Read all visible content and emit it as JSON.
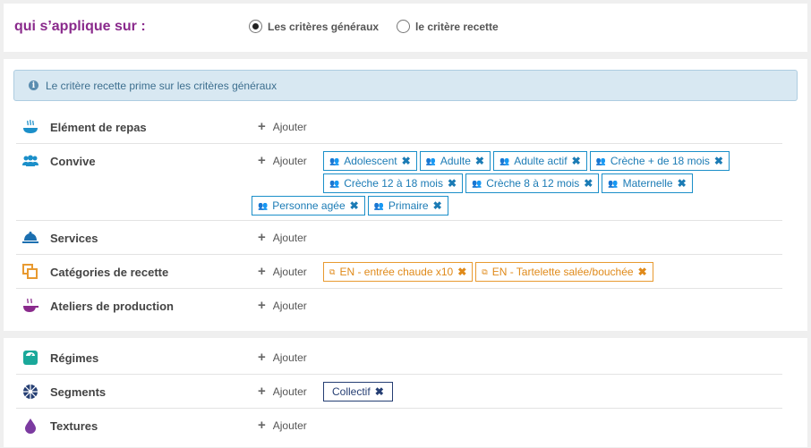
{
  "apply": {
    "title": "qui s’applique sur :",
    "options": [
      {
        "label": "Les critères généraux",
        "checked": true
      },
      {
        "label": "le critère recette",
        "checked": false
      }
    ]
  },
  "info": {
    "text": "Le critère recette prime sur les critères généraux"
  },
  "add_label": "Ajouter",
  "rows": [
    {
      "label": "Elément de repas",
      "icon": "meal-element-icon",
      "tags": []
    },
    {
      "label": "Convive",
      "icon": "people-icon",
      "tags": [
        "Adolescent",
        "Adulte",
        "Adulte actif",
        "Crèche + de 18 mois",
        "Crèche 12 à 18 mois",
        "Crèche 8 à 12 mois",
        "Maternelle",
        "Personne agée",
        "Primaire"
      ]
    },
    {
      "label": "Services",
      "icon": "cloche-icon",
      "tags": []
    },
    {
      "label": "Catégories de recette",
      "icon": "copy-icon",
      "tags": [
        "EN - entrée chaude x10",
        "EN - Tartelette salée/bouchée"
      ]
    },
    {
      "label": "Ateliers de production",
      "icon": "cooking-pot-icon",
      "tags": []
    },
    {
      "label": "Régimes",
      "icon": "scale-icon",
      "tags": []
    },
    {
      "label": "Segments",
      "icon": "segments-icon",
      "tags": [
        "Collectif"
      ]
    },
    {
      "label": "Textures",
      "icon": "drop-icon",
      "tags": []
    }
  ],
  "colors": {
    "title": "#8a2a8c",
    "tag_blue": "#1b8fc9",
    "tag_orange": "#e89a30",
    "tag_navy": "#253e73"
  }
}
